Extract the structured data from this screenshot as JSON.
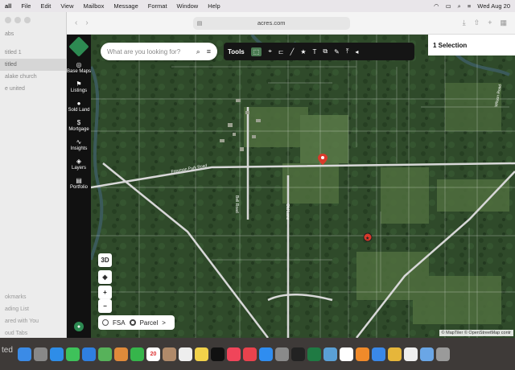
{
  "menubar": {
    "app": "all",
    "items": [
      "File",
      "Edit",
      "View",
      "Mailbox",
      "Message",
      "Format",
      "Window",
      "Help"
    ],
    "clock": "Wed Aug 20"
  },
  "sidebar": {
    "items": [
      {
        "label": "abs",
        "selected": false
      },
      {
        "label": "titled 1",
        "selected": false
      },
      {
        "label": "titled",
        "selected": true
      },
      {
        "label": "alake church",
        "selected": false
      },
      {
        "label": "e united",
        "selected": false
      }
    ],
    "bottom_items": [
      "okmarks",
      "ading List",
      "ared with You",
      "oud Tabs"
    ]
  },
  "browser": {
    "url": "acres.com"
  },
  "appnav": {
    "items": [
      {
        "label": "Base Maps",
        "icon": "globe-icon",
        "glyph": "◎"
      },
      {
        "label": "Listings",
        "icon": "flag-icon",
        "glyph": "⚑"
      },
      {
        "label": "Sold Land",
        "icon": "pin-icon",
        "glyph": "●"
      },
      {
        "label": "Mortgage",
        "icon": "dollar-icon",
        "glyph": "$"
      },
      {
        "label": "Insights",
        "icon": "trend-icon",
        "glyph": "∿"
      },
      {
        "label": "Layers",
        "icon": "layers-icon",
        "glyph": "◈"
      },
      {
        "label": "Portfolio",
        "icon": "map-icon",
        "glyph": "▤"
      }
    ]
  },
  "map": {
    "search_placeholder": "What are you looking for?",
    "tools_label": "Tools",
    "selection_label": "1 Selection",
    "btn_3d": "3D",
    "zoom_in": "+",
    "zoom_out": "−",
    "fsa_label": "FSA",
    "parcel_label": "Parcel",
    "parcel_arrow": ">",
    "attribution": "© MapTiler © OpenStreetMap contr",
    "road_labels": [
      "Freeman Park Road",
      "Bell Road",
      "Old Lane",
      "Wilson Road"
    ],
    "colors": {
      "accent": "#2d8a52",
      "pin": "#d93a2b",
      "road": "#d8d8d8"
    }
  },
  "dock": {
    "label": "ted",
    "apps": [
      {
        "name": "finder-icon",
        "color": "#3b8be6"
      },
      {
        "name": "launchpad-icon",
        "color": "#888888"
      },
      {
        "name": "safari-icon",
        "color": "#2e8de8"
      },
      {
        "name": "messages-icon",
        "color": "#3ec25a"
      },
      {
        "name": "mail-icon",
        "color": "#2f7fe0"
      },
      {
        "name": "maps-icon",
        "color": "#57b25a"
      },
      {
        "name": "photos-icon",
        "color": "#e08a3a"
      },
      {
        "name": "facetime-icon",
        "color": "#36b54b"
      },
      {
        "name": "calendar-icon",
        "color": "#ffffff"
      },
      {
        "name": "contacts-icon",
        "color": "#b08a6a"
      },
      {
        "name": "reminders-icon",
        "color": "#eeeeee"
      },
      {
        "name": "notes-icon",
        "color": "#f2d24a"
      },
      {
        "name": "tv-icon",
        "color": "#111111"
      },
      {
        "name": "music-icon",
        "color": "#f0455a"
      },
      {
        "name": "news-icon",
        "color": "#e9424d"
      },
      {
        "name": "appstore-icon",
        "color": "#2f8df0"
      },
      {
        "name": "settings-icon",
        "color": "#8a8a8a"
      },
      {
        "name": "terminal-icon",
        "color": "#222222"
      },
      {
        "name": "excel-icon",
        "color": "#1f7a43"
      },
      {
        "name": "screenshot-icon",
        "color": "#5aa0d6"
      },
      {
        "name": "freeform-icon",
        "color": "#ffffff"
      },
      {
        "name": "pages-icon",
        "color": "#f08a2a"
      },
      {
        "name": "keynote-icon",
        "color": "#3a88e8"
      },
      {
        "name": "chrome-icon",
        "color": "#e6b63a"
      },
      {
        "name": "document-icon",
        "color": "#eeeeee"
      },
      {
        "name": "downloads-icon",
        "color": "#6aa6e6"
      },
      {
        "name": "trash-icon",
        "color": "#9a9a9a"
      }
    ],
    "calendar_day": "20"
  }
}
